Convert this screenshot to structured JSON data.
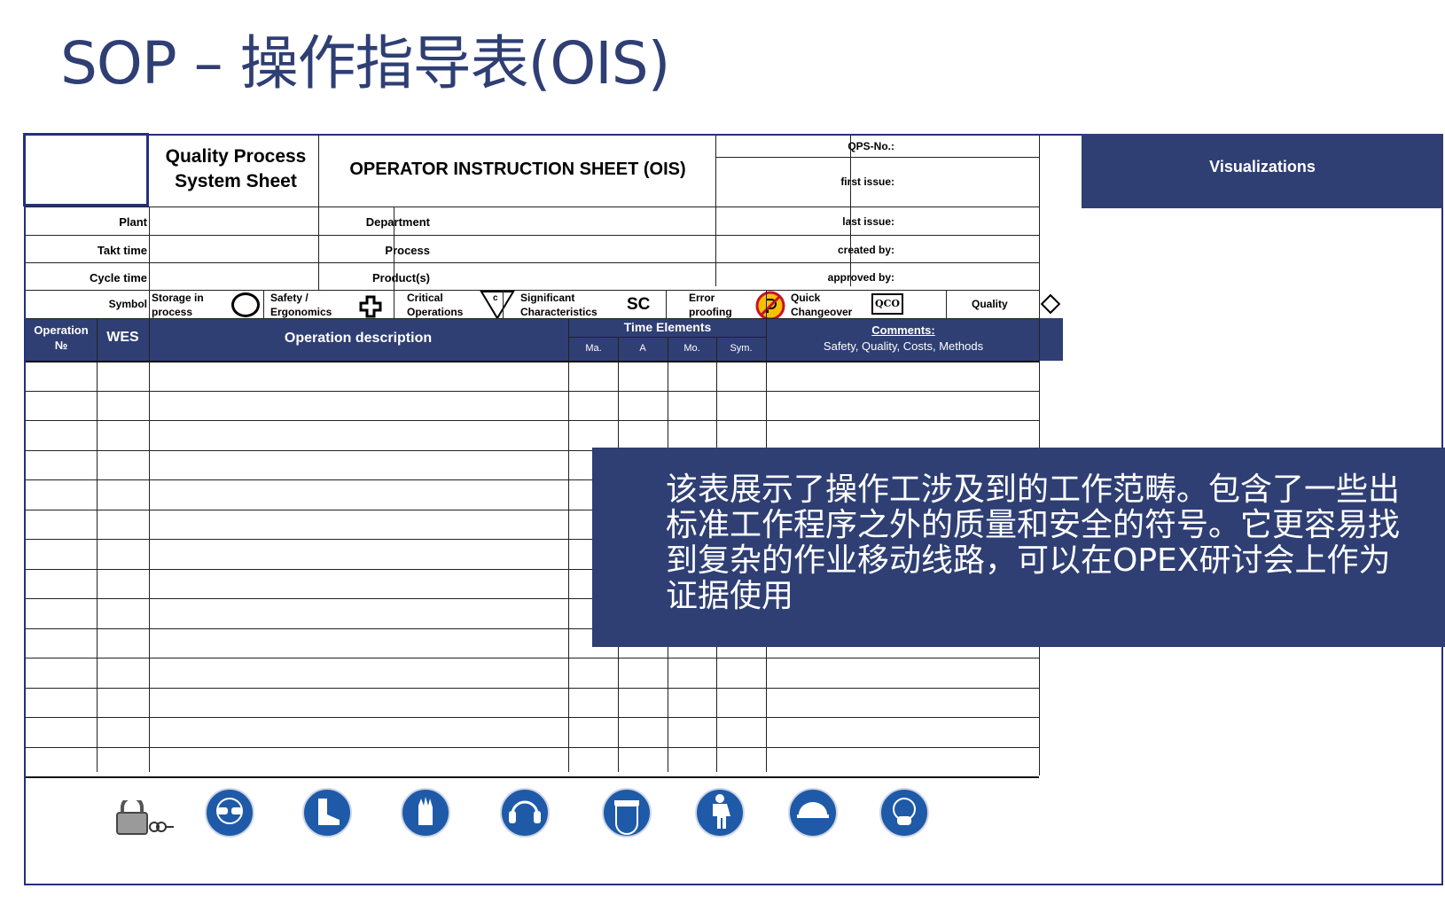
{
  "slide_title": "SOP – 操作指导表(OIS)",
  "header": {
    "qps_title_line1": "Quality Process",
    "qps_title_line2": "System Sheet",
    "sheet_title": "OPERATOR INSTRUCTION SHEET (OIS)",
    "visualizations": "Visualizations",
    "qps_no": "QPS-No.:",
    "first_issue": "first issue:",
    "last_issue": "last issue:",
    "created_by": "created by:",
    "approved_by": "approved by:"
  },
  "fields": {
    "plant": "Plant",
    "takt_time": "Takt time",
    "cycle_time": "Cycle time",
    "department": "Department",
    "process": "Process",
    "products": "Product(s)"
  },
  "symbols": {
    "label": "Symbol",
    "storage_1": "Storage in",
    "storage_2": "process",
    "safety_1": "Safety /",
    "safety_2": "Ergonomics",
    "critical_1": "Critical",
    "critical_2": "Operations",
    "critical_mark": "c",
    "significant_1": "Significant",
    "significant_2": "Characteristics",
    "sc": "SC",
    "error_1": "Error",
    "error_2": "proofing",
    "quick_1": "Quick",
    "quick_2": "Changeover",
    "qco": "QCO",
    "quality": "Quality"
  },
  "table_header": {
    "operation_1": "Operation",
    "operation_2": "№",
    "wes": "WES",
    "description": "Operation description",
    "time_elements": "Time Elements",
    "ma": "Ma.",
    "a": "A",
    "mo": "Mo.",
    "sym": "Sym.",
    "comments": "Comments:",
    "comments_sub": "Safety, Quality, Costs, Methods"
  },
  "overlay_text": "该表展示了操作工涉及到的工作范畴。包含了一些出标准工作程序之外的质量和安全的符号。它更容易找到复杂的作业移动线路，可以在OPEX研讨会上作为证据使用",
  "colors": {
    "navy": "#2f3f74",
    "border": "#24307e",
    "ppe_blue": "#1f5aa8"
  },
  "ppe_icons": [
    "lockout-padlock-icon",
    "safety-glasses-icon",
    "safety-boots-icon",
    "protective-gloves-icon",
    "ear-protection-icon",
    "face-shield-icon",
    "protective-clothing-icon",
    "hard-hat-icon",
    "respirator-mask-icon"
  ]
}
